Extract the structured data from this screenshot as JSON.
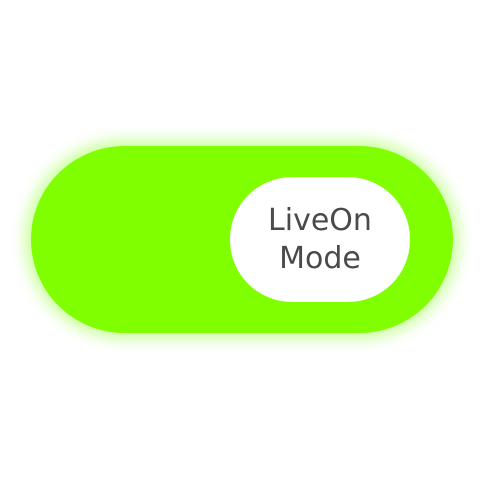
{
  "toggle": {
    "state": "on",
    "label_line1": "LiveOn",
    "label_line2": "Mode",
    "track_color": "#7fff00",
    "knob_color": "#ffffff",
    "text_color": "#4a4a4a"
  }
}
